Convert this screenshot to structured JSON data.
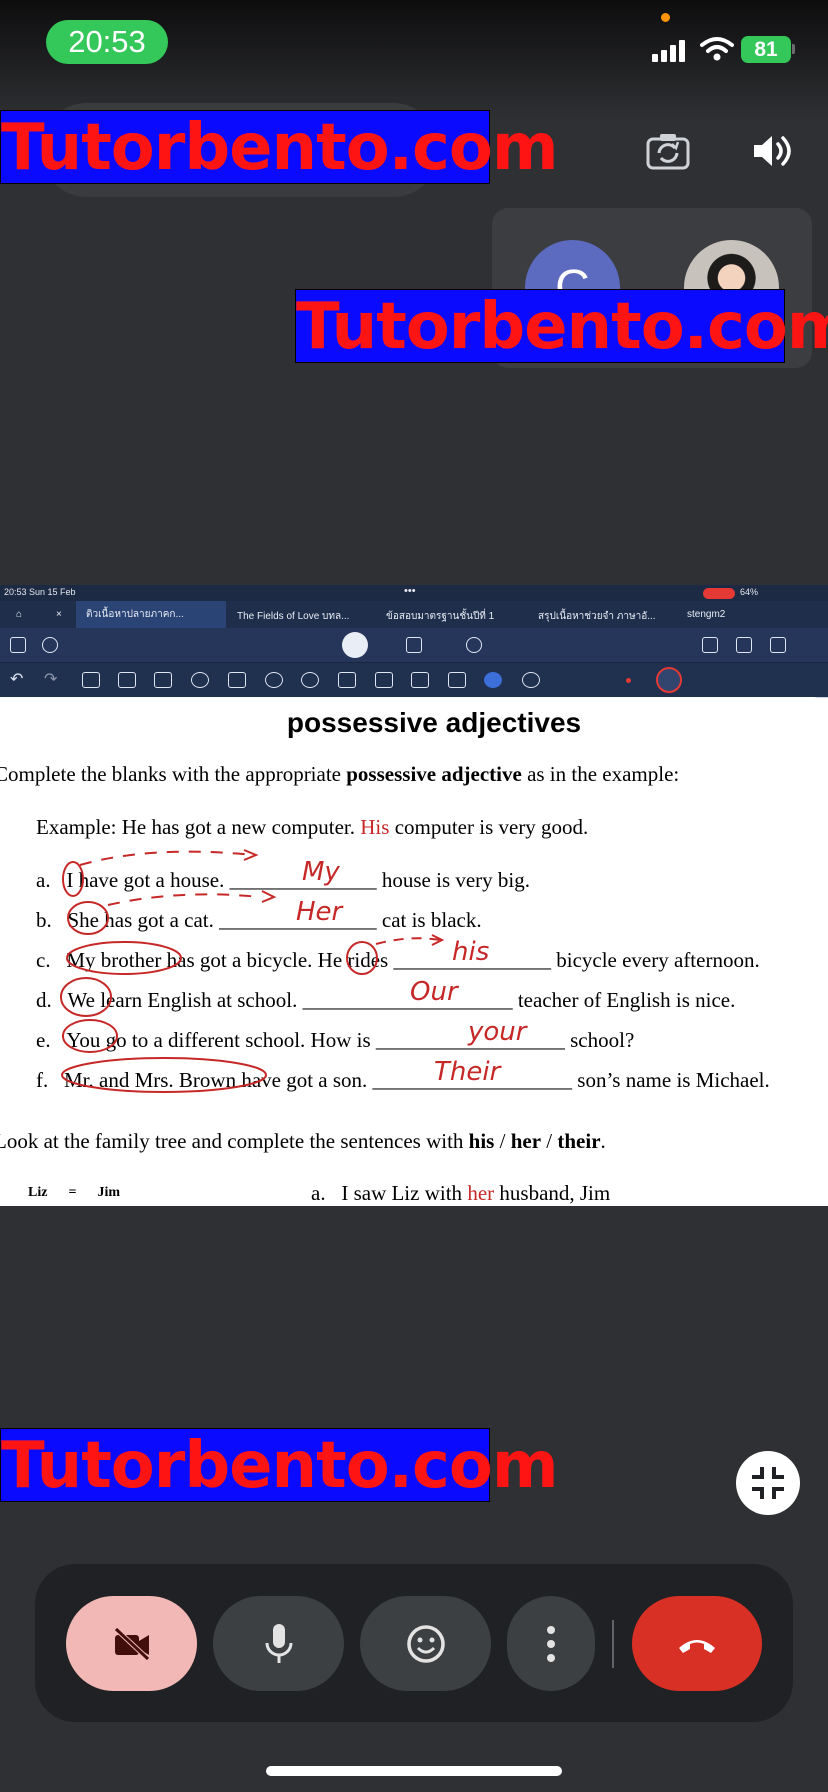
{
  "status_bar": {
    "time": "20:53",
    "battery": "81"
  },
  "watermark": "Tutorbento.com",
  "participants": [
    {
      "initial": "C"
    },
    {
      "initial": ""
    }
  ],
  "ipad": {
    "time": "20:53  Sun 15 Feb",
    "battery": "64%",
    "tabs": [
      "ติวเนื้อหาปลายภาคก...",
      "The Fields of Love บทล...",
      "ข้อสอบมาตรฐานชั้นปีที่ 1",
      "สรุปเนื้อหาช่วยจำ ภาษาอั...",
      "stengm2"
    ]
  },
  "document": {
    "title": "possessive adjectives",
    "instruction_pre": "Complete the blanks with the appropriate ",
    "instruction_bold": "possessive adjective",
    "instruction_post": " as in the example:",
    "example_pre": "Example: He has got a new computer. ",
    "example_word": "His",
    "example_post": " computer is very good.",
    "items": [
      {
        "letter": "a.",
        "text": "I have got a house. ______________ house is very big.",
        "answer": "My"
      },
      {
        "letter": "b.",
        "text": "She has got a cat. _______________ cat is black.",
        "answer": "Her"
      },
      {
        "letter": "c.",
        "text": "My brother has got a bicycle. He rides _______________ bicycle every afternoon.",
        "answer": "his"
      },
      {
        "letter": "d.",
        "text": "We learn English at school. ____________________ teacher of English is nice.",
        "answer": "Our"
      },
      {
        "letter": "e.",
        "text": "You go to a different school. How is __________________ school?",
        "answer": "your"
      },
      {
        "letter": "f.",
        "text": "Mr. and Mrs. Brown have got a son. ___________________ son’s name is Michael.",
        "answer": "Their"
      }
    ],
    "section2_pre": "Look at the family tree and complete the sentences with ",
    "section2_his": "his",
    "section2_sep1": " / ",
    "section2_her": "her",
    "section2_sep2": " / ",
    "section2_their": "their",
    "section2_end": ".",
    "tree_left": "Liz",
    "tree_eq": "=",
    "tree_right": "Jim",
    "sentence_a_letter": "a.",
    "sentence_a_pre": "I saw Liz with ",
    "sentence_a_word": "her",
    "sentence_a_post": " husband, Jim"
  }
}
